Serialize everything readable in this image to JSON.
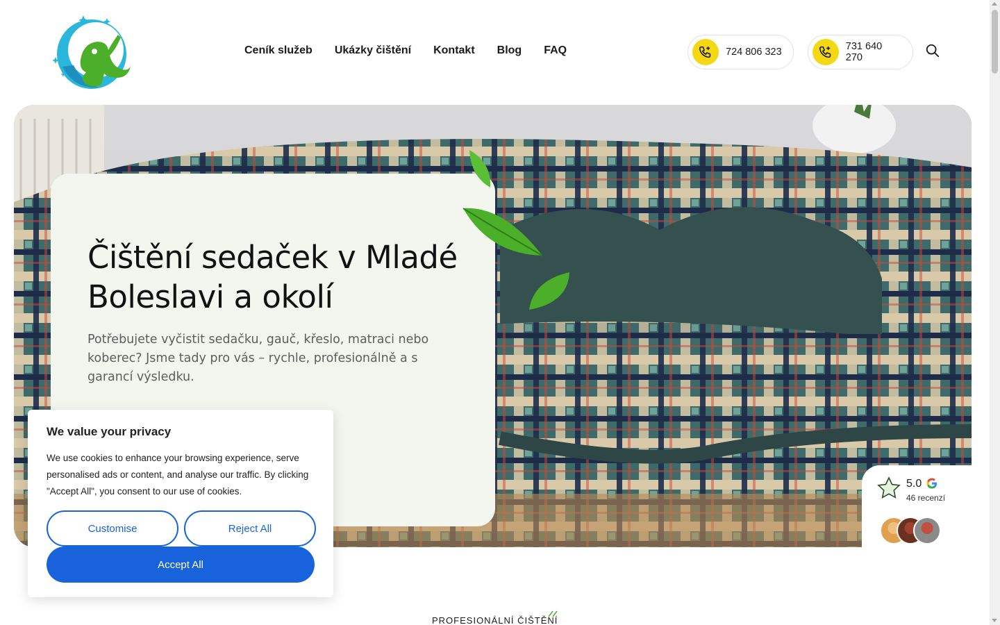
{
  "header": {
    "logo_icon": "monkey-cleaning-logo",
    "nav": [
      {
        "label": "Ceník služeb"
      },
      {
        "label": "Ukázky čištění"
      },
      {
        "label": "Kontakt"
      },
      {
        "label": "Blog"
      },
      {
        "label": "FAQ"
      }
    ],
    "phones": [
      {
        "number": "724 806 323",
        "icon": "phone-icon"
      },
      {
        "number": "731 640 270",
        "icon": "phone-icon"
      }
    ],
    "search_icon": "search-icon"
  },
  "hero": {
    "title": "Čištění sedaček v Mladé Boleslavi a okolí",
    "text": "Potřebujete vyčistit sedačku, gauč, křeslo, matraci nebo koberec? Jsme tady pro vás – rychle, profesionálně a s garancí výsledku."
  },
  "rating": {
    "score": "5.0",
    "count": "46 recenzí",
    "icons": [
      "star-icon",
      "google-icon"
    ]
  },
  "section": {
    "label": "PROFESIONÁLNÍ ČIŠTĚNÍ"
  },
  "cookie": {
    "title": "We value your privacy",
    "text": "We use cookies to enhance your browsing experience, serve personalised ads or content, and analyse our traffic. By clicking \"Accept All\", you consent to our use of cookies.",
    "customise": "Customise",
    "reject": "Reject All",
    "accept": "Accept All"
  },
  "colors": {
    "accent_yellow": "#f5d814",
    "cookie_blue": "#1863dc",
    "hero_card_bg": "#f3f6ef",
    "leaf_green": "#4caf2a"
  }
}
